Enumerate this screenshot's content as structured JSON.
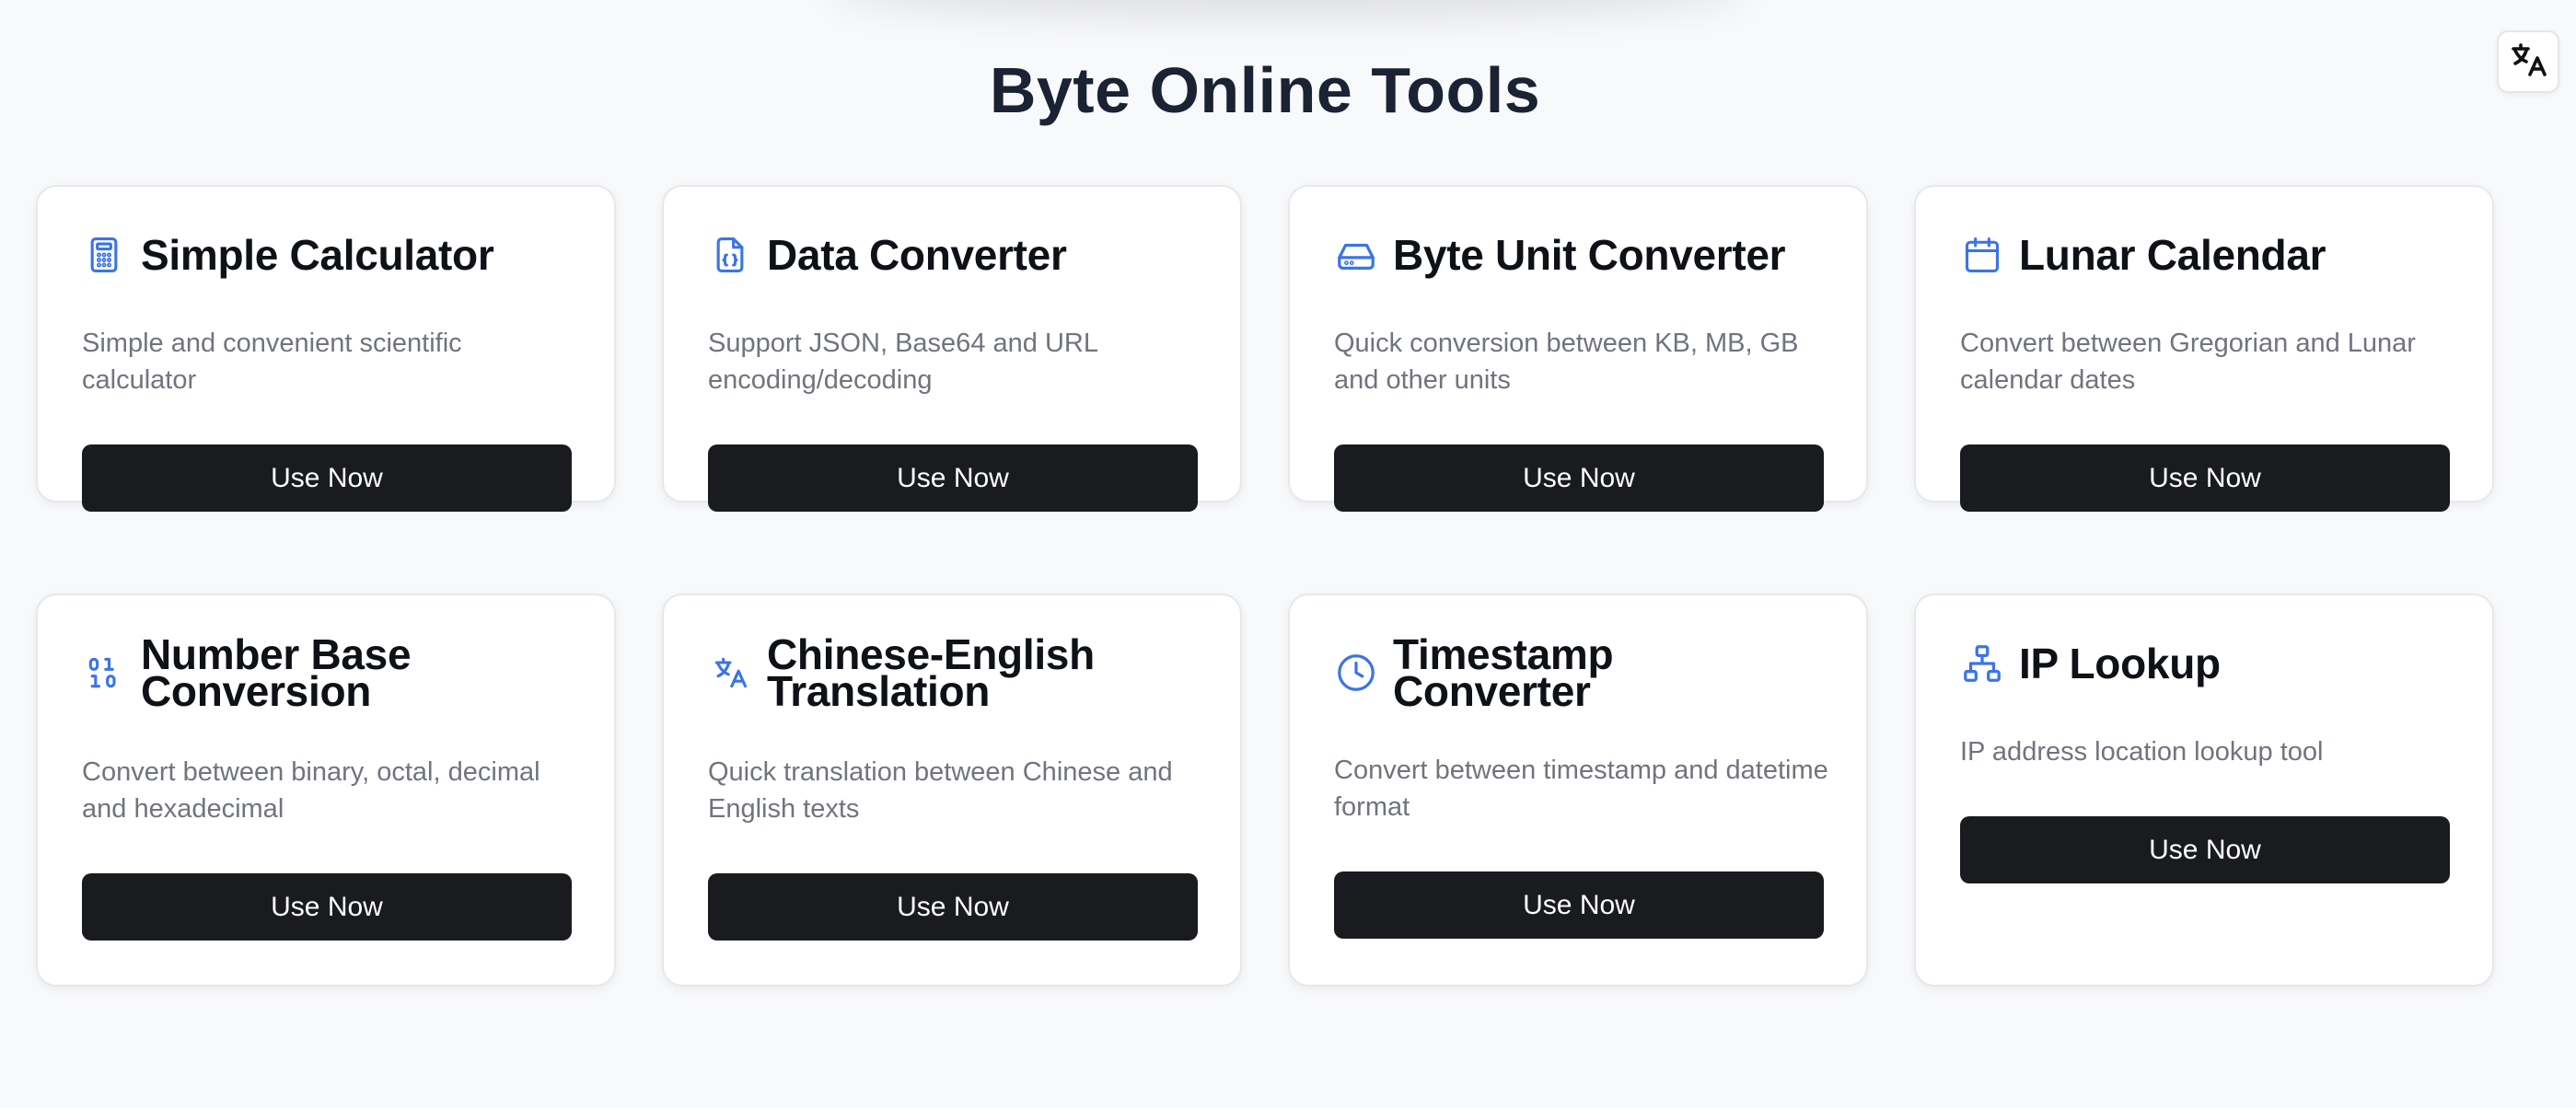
{
  "page": {
    "title": "Byte Online Tools"
  },
  "colors": {
    "accent": "#3b74e6",
    "button_bg": "#1a1b1e",
    "title": "#1a2233",
    "desc": "#70747c"
  },
  "language_toggle": {
    "icon": "translate-icon"
  },
  "tools": [
    {
      "icon": "calculator-icon",
      "title": "Simple Calculator",
      "description": "Simple and convenient scientific calculator",
      "button": "Use Now"
    },
    {
      "icon": "code-file-icon",
      "title": "Data Converter",
      "description": "Support JSON, Base64 and URL encoding/decoding",
      "button": "Use Now"
    },
    {
      "icon": "hard-drive-icon",
      "title": "Byte Unit Converter",
      "description": "Quick conversion between KB, MB, GB and other units",
      "button": "Use Now"
    },
    {
      "icon": "calendar-icon",
      "title": "Lunar Calendar",
      "description": "Convert between Gregorian and Lunar calendar dates",
      "button": "Use Now"
    },
    {
      "icon": "binary-icon",
      "title": "Number Base Conversion",
      "description": "Convert between binary, octal, decimal and hexadecimal",
      "button": "Use Now"
    },
    {
      "icon": "translate-icon",
      "title": "Chinese-English Translation",
      "description": "Quick translation between Chinese and English texts",
      "button": "Use Now"
    },
    {
      "icon": "clock-icon",
      "title": "Timestamp Converter",
      "description": "Convert between timestamp and datetime format",
      "button": "Use Now"
    },
    {
      "icon": "network-icon",
      "title": "IP Lookup",
      "description": "IP address location lookup tool",
      "button": "Use Now"
    }
  ]
}
